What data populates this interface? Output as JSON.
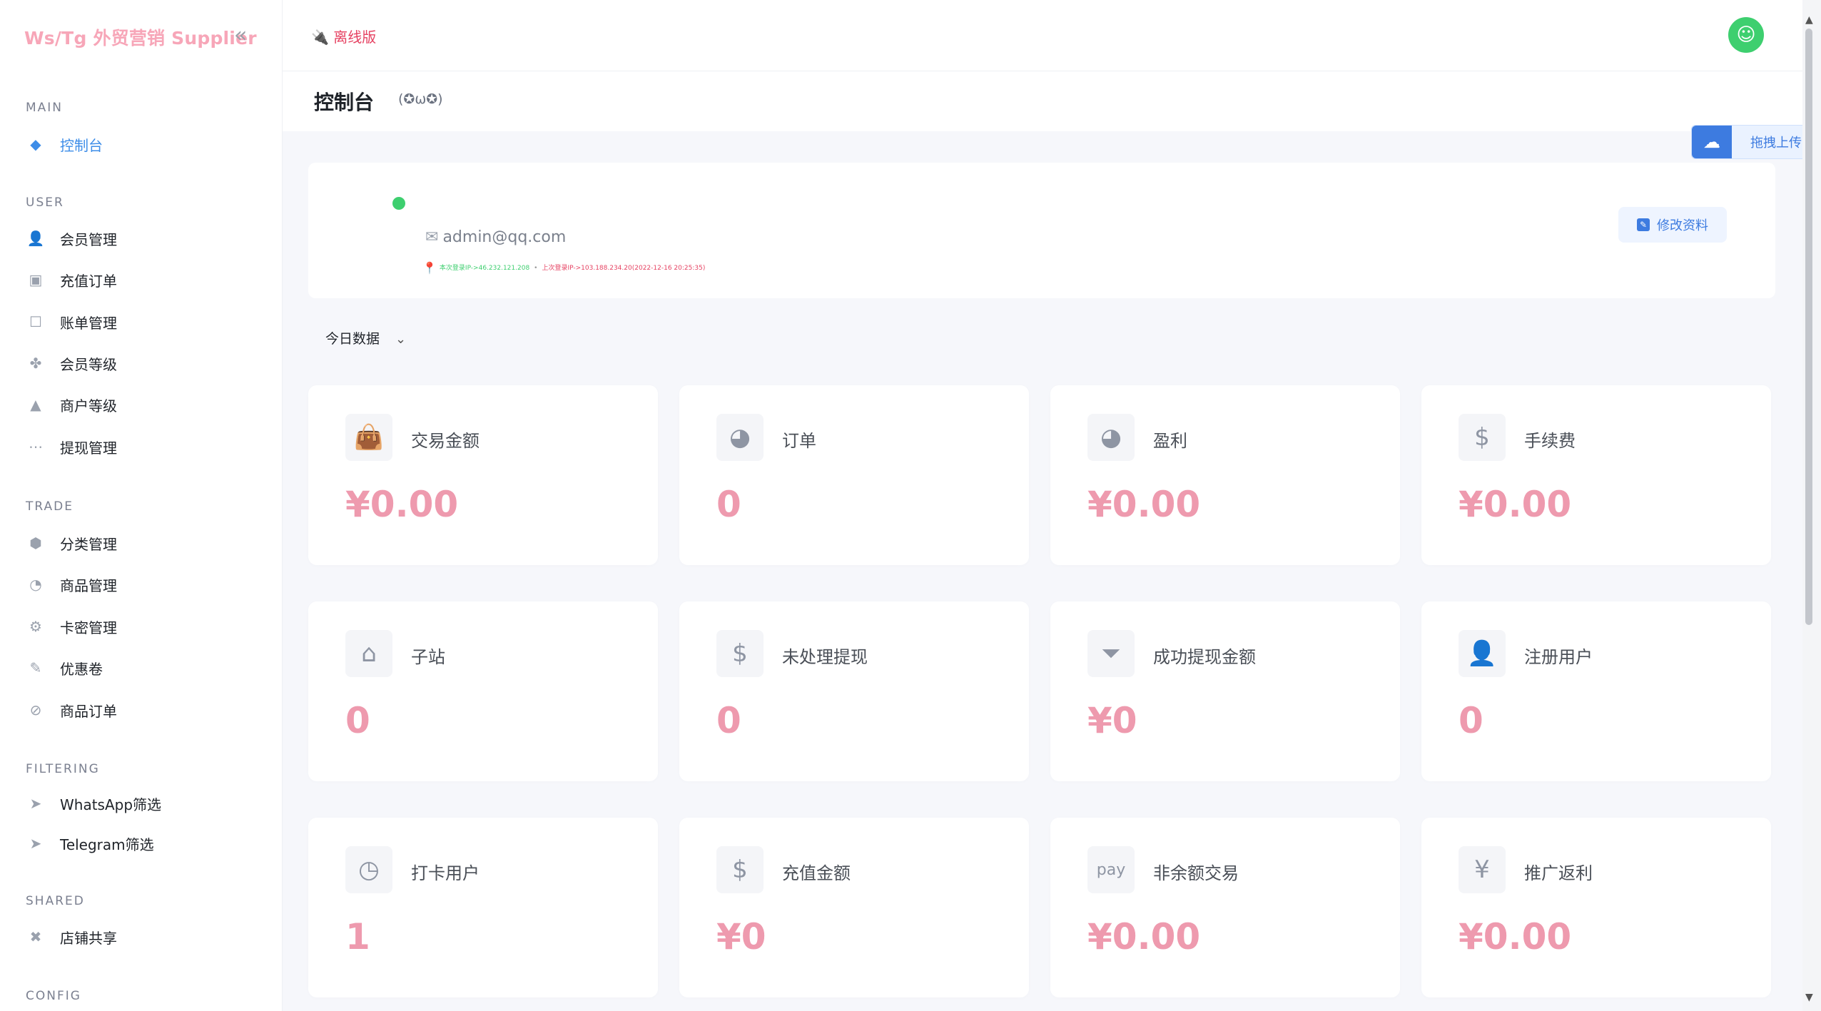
{
  "brand": "Ws/Tg 外贸营销 Supplier",
  "header": {
    "offline_label": "离线版",
    "page_title": "控制台",
    "page_subtitle": "(✪ω✪)"
  },
  "upload": {
    "label": "拖拽上传"
  },
  "sidebar": {
    "sections": [
      {
        "title": "MAIN",
        "items": [
          {
            "label": "控制台",
            "icon": "dashboard-icon",
            "active": true
          }
        ]
      },
      {
        "title": "USER",
        "items": [
          {
            "label": "会员管理",
            "icon": "user-icon"
          },
          {
            "label": "充值订单",
            "icon": "recharge-icon"
          },
          {
            "label": "账单管理",
            "icon": "bill-icon"
          },
          {
            "label": "会员等级",
            "icon": "level-icon"
          },
          {
            "label": "商户等级",
            "icon": "merchant-icon"
          },
          {
            "label": "提现管理",
            "icon": "withdraw-icon"
          }
        ]
      },
      {
        "title": "TRADE",
        "items": [
          {
            "label": "分类管理",
            "icon": "category-icon"
          },
          {
            "label": "商品管理",
            "icon": "goods-icon"
          },
          {
            "label": "卡密管理",
            "icon": "card-icon"
          },
          {
            "label": "优惠卷",
            "icon": "coupon-icon"
          },
          {
            "label": "商品订单",
            "icon": "order-icon"
          }
        ]
      },
      {
        "title": "FILTERING",
        "items": [
          {
            "label": "WhatsApp筛选",
            "icon": "telegram-icon"
          },
          {
            "label": "Telegram筛选",
            "icon": "telegram-icon"
          }
        ]
      },
      {
        "title": "SHARED",
        "items": [
          {
            "label": "店铺共享",
            "icon": "share-icon"
          }
        ]
      },
      {
        "title": "CONFIG",
        "items": []
      }
    ]
  },
  "profile": {
    "email": "admin@qq.com",
    "current_login": "本次登录IP->46.232.121.208",
    "last_login": "上次登录IP->103.188.234.20(2022-12-16 20:25:35)",
    "edit_label": "修改资料"
  },
  "filter": {
    "label": "今日数据"
  },
  "stats": [
    {
      "label": "交易金额",
      "value": "¥0.00",
      "icon": "bag-icon"
    },
    {
      "label": "订单",
      "value": "0",
      "icon": "pie-chart-icon"
    },
    {
      "label": "盈利",
      "value": "¥0.00",
      "icon": "pie-chart-icon"
    },
    {
      "label": "手续费",
      "value": "¥0.00",
      "icon": "fee-icon"
    },
    {
      "label": "子站",
      "value": "0",
      "icon": "house-icon"
    },
    {
      "label": "未处理提现",
      "value": "0",
      "icon": "dollar-icon"
    },
    {
      "label": "成功提现金额",
      "value": "¥0",
      "icon": "funnel-icon"
    },
    {
      "label": "注册用户",
      "value": "0",
      "icon": "user-plus-icon"
    },
    {
      "label": "打卡用户",
      "value": "1",
      "icon": "clock-icon"
    },
    {
      "label": "充值金额",
      "value": "¥0",
      "icon": "hand-dollar-icon"
    },
    {
      "label": "非余额交易",
      "value": "¥0.00",
      "icon": "pay-icon"
    },
    {
      "label": "推广返利",
      "value": "¥0.00",
      "icon": "yen-icon"
    }
  ],
  "colors": {
    "accent": "#3d8de8",
    "value_pink": "#ee9aae",
    "online_green": "#3ecf6f",
    "danger": "#e64262"
  }
}
